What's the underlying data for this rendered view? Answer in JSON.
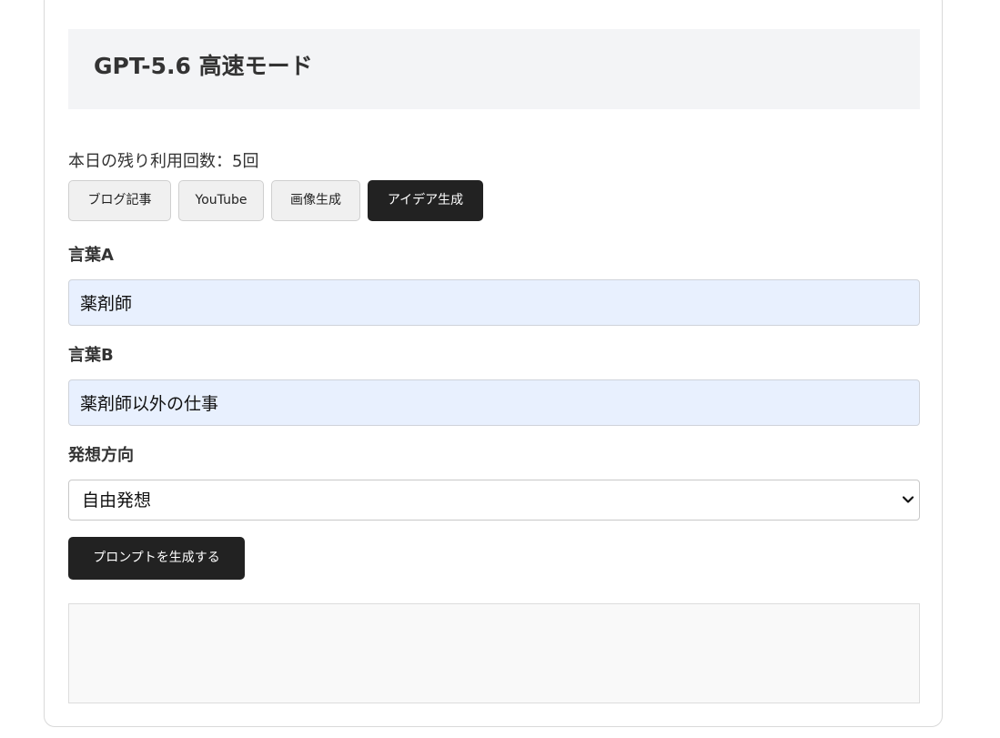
{
  "header": {
    "title": "GPT-5.6 高速モード"
  },
  "usage": {
    "text": "本日の残り利用回数：5回"
  },
  "tabs": [
    {
      "label": "ブログ記事",
      "active": false
    },
    {
      "label": "YouTube",
      "active": false
    },
    {
      "label": "画像生成",
      "active": false
    },
    {
      "label": "アイデア生成",
      "active": true
    }
  ],
  "form": {
    "word_a": {
      "label": "言葉A",
      "value": "薬剤師"
    },
    "word_b": {
      "label": "言葉B",
      "value": "薬剤師以外の仕事"
    },
    "direction": {
      "label": "発想方向",
      "selected": "自由発想"
    },
    "submit_label": "プロンプトを生成する"
  },
  "output": {
    "text": ""
  },
  "colors": {
    "accent": "#222222",
    "header_bg": "#f3f4f6",
    "input_bg": "#e8f0fe",
    "output_bg": "#f9f9f9"
  },
  "icons": {
    "select_arrow": "chevron-down-icon"
  }
}
